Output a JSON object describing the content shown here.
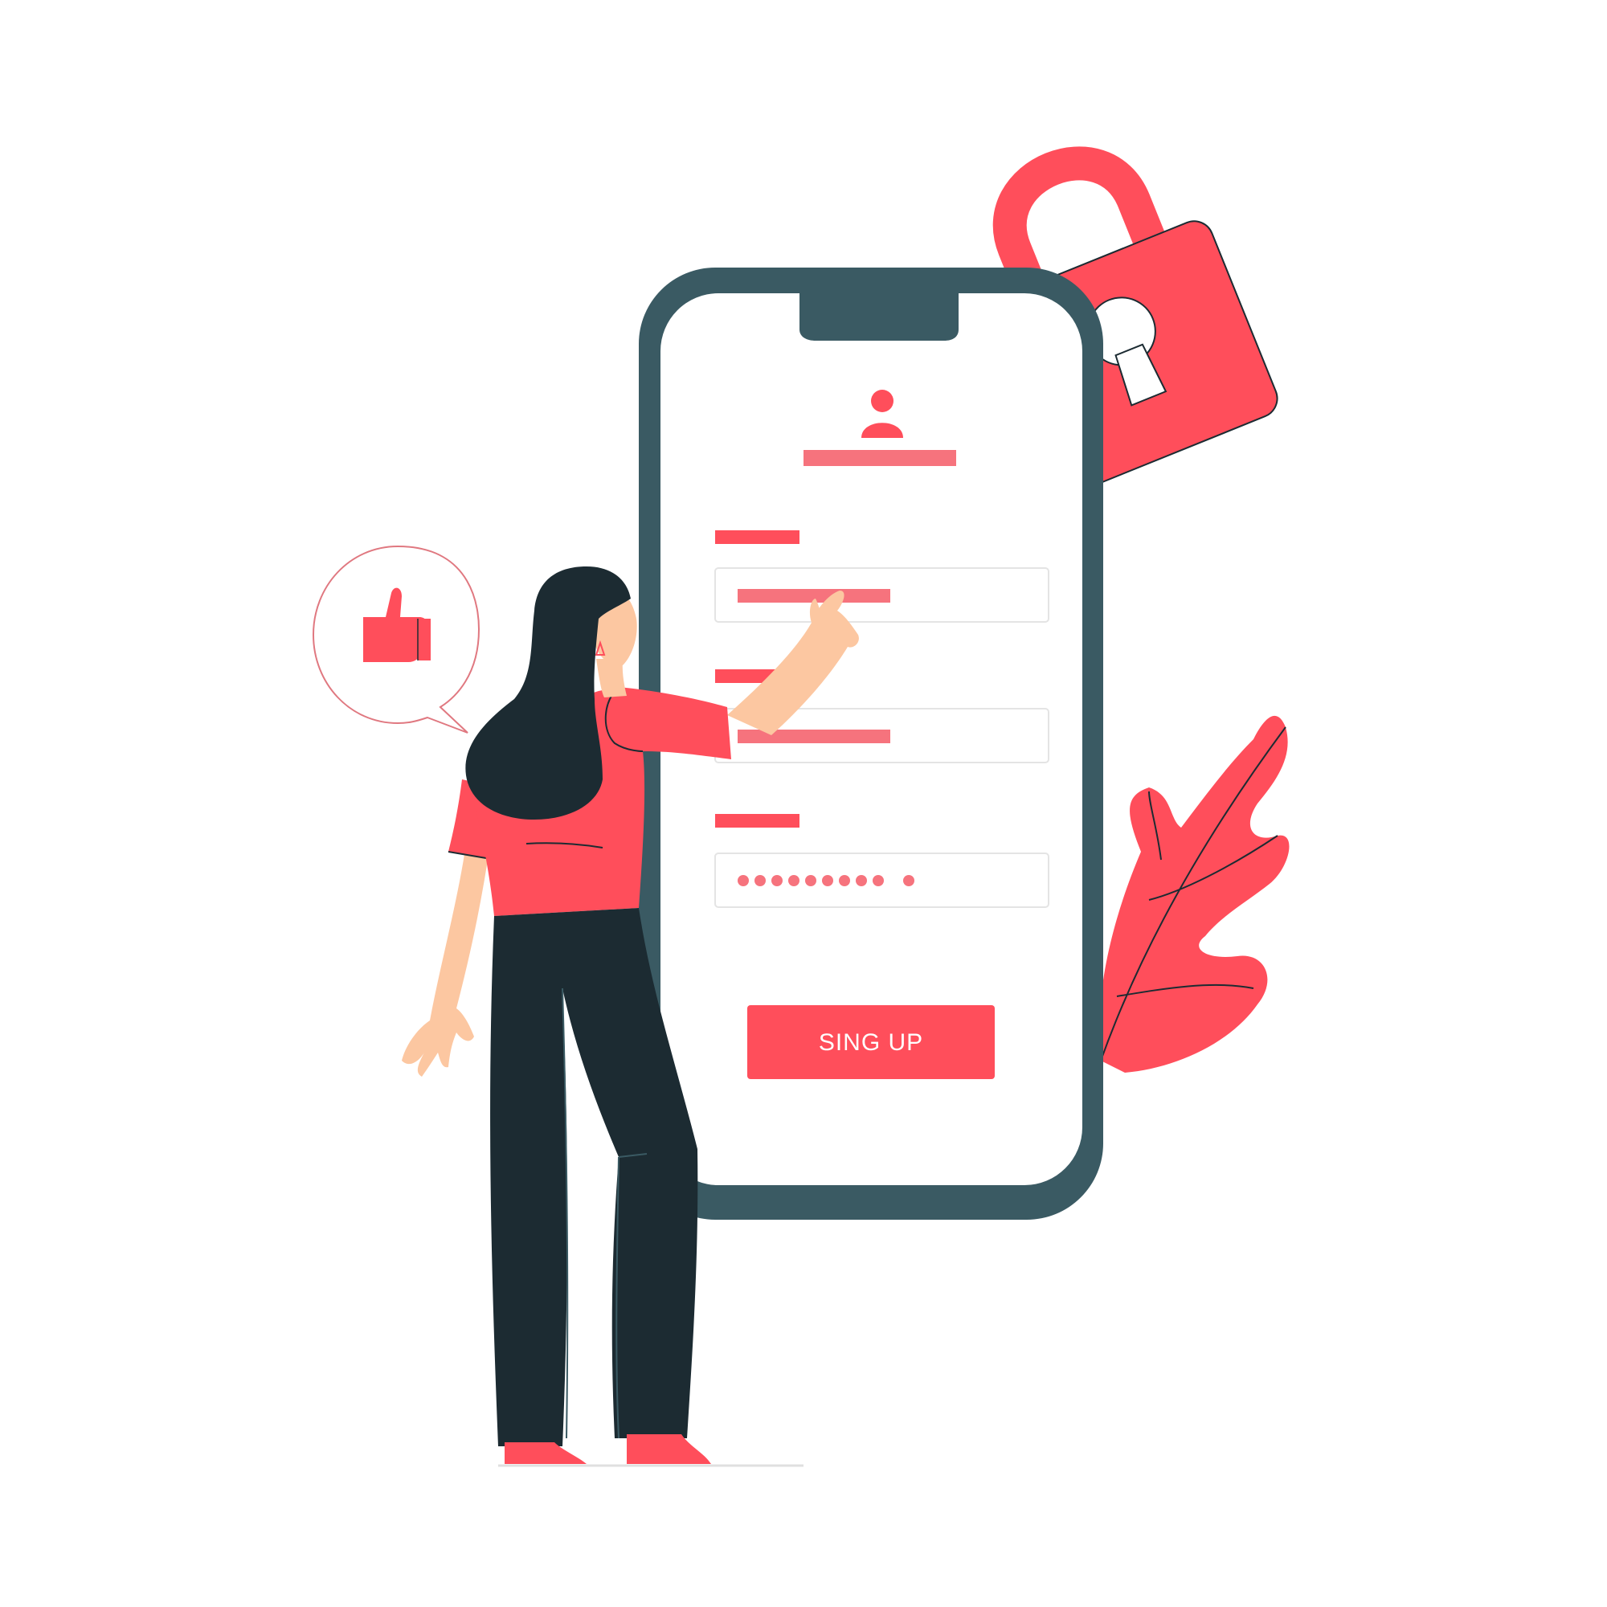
{
  "signup_button": {
    "label": "SING UP"
  },
  "password_field": {
    "masked_value": "••••••••••"
  },
  "icons": {
    "user": "user-icon",
    "lock": "padlock-icon",
    "like": "thumbs-up-icon"
  },
  "colors": {
    "accent": "#FF4E5B",
    "accent_light": "#F6737D",
    "phone_frame": "#3A5A63",
    "dark": "#1C2B32",
    "skin": "#FCC7A1",
    "background": "#FFFFFF"
  }
}
